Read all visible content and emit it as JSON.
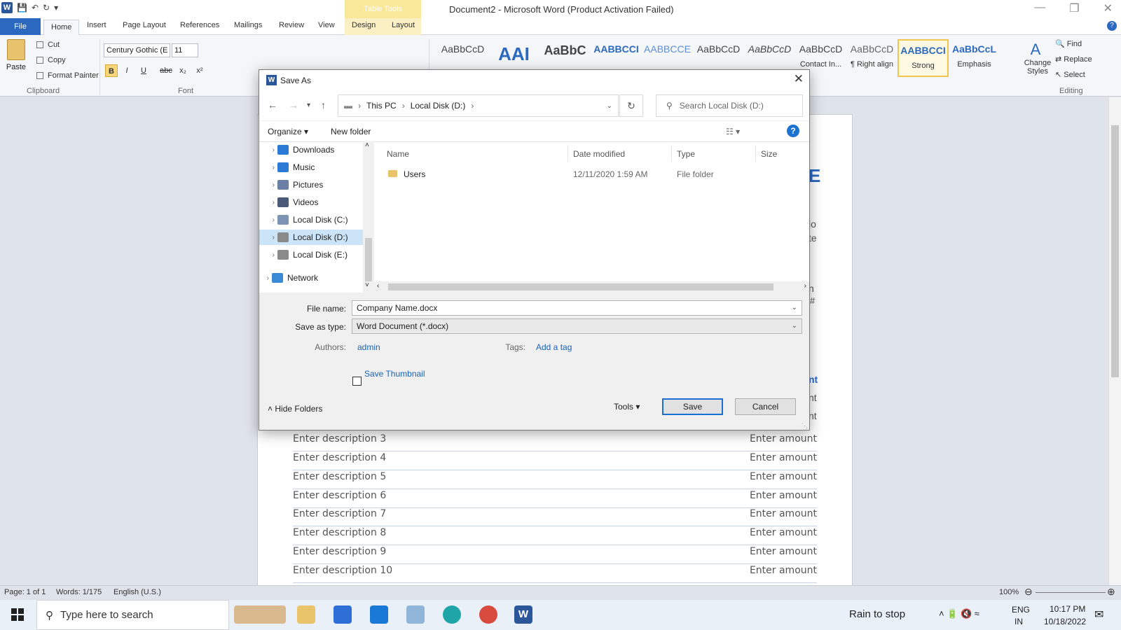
{
  "titlebar": {
    "title": "Document2 - Microsoft Word (Product Activation Failed)",
    "table_tools": "Table Tools",
    "minimize": "—",
    "restore": "❐",
    "close": "✕"
  },
  "ribbon_tabs": [
    "File",
    "Home",
    "Insert",
    "Page Layout",
    "References",
    "Mailings",
    "Review",
    "View",
    "Design",
    "Layout"
  ],
  "clipboard": {
    "paste": "Paste",
    "cut": "Cut",
    "copy": "Copy",
    "format_painter": "Format Painter",
    "group_label": "Clipboard"
  },
  "font": {
    "name": "Century Gothic (E",
    "size": "11",
    "group_label": "Font",
    "bold": "B",
    "italic": "I",
    "underline": "U",
    "strike": "abc",
    "subscript": "x₂",
    "superscript": "x²"
  },
  "styles": {
    "tiles": [
      {
        "sample": "AaBbCcD",
        "name": ""
      },
      {
        "sample": "AAI",
        "name": ""
      },
      {
        "sample": "AaBbC",
        "name": ""
      },
      {
        "sample": "AABBCCI",
        "name": ""
      },
      {
        "sample": "AABBCCE",
        "name": ""
      },
      {
        "sample": "AaBbCcD",
        "name": ""
      },
      {
        "sample": "AaBbCcD",
        "name": ""
      },
      {
        "sample": "AaBbCcD",
        "name": "Contact In..."
      },
      {
        "sample": "AaBbCcD",
        "name": "¶ Right align"
      },
      {
        "sample": "AABBCCI",
        "name": "Strong"
      },
      {
        "sample": "AaBbCcL",
        "name": "Emphasis"
      }
    ],
    "change_styles": "Change Styles",
    "group_label": "Styles"
  },
  "editing": {
    "find": "Find",
    "replace": "Replace",
    "select": "Select",
    "group_label": "Editing"
  },
  "document": {
    "rows": [
      {
        "desc": "Enter description 3",
        "amount": "Enter amount"
      },
      {
        "desc": "Enter description 4",
        "amount": "Enter amount"
      },
      {
        "desc": "Enter description 5",
        "amount": "Enter amount"
      },
      {
        "desc": "Enter description 6",
        "amount": "Enter amount"
      },
      {
        "desc": "Enter description 7",
        "amount": "Enter amount"
      },
      {
        "desc": "Enter description 8",
        "amount": "Enter amount"
      },
      {
        "desc": "Enter description 9",
        "amount": "Enter amount"
      },
      {
        "desc": "Enter description 10",
        "amount": "Enter amount"
      }
    ],
    "partial_right": [
      "E",
      "lo",
      "te",
      "n",
      "#",
      "nt",
      "nt",
      "nt"
    ]
  },
  "status": {
    "page": "Page: 1 of 1",
    "words": "Words: 1/175",
    "language": "English (U.S.)",
    "zoom": "100%"
  },
  "dialog": {
    "title": "Save As",
    "breadcrumb": [
      "This PC",
      "Local Disk (D:)"
    ],
    "search_placeholder": "Search Local Disk (D:)",
    "organize": "Organize",
    "new_folder": "New folder",
    "tree": [
      {
        "label": "Downloads",
        "color": "#2b7bd6"
      },
      {
        "label": "Music",
        "color": "#2b7bd6"
      },
      {
        "label": "Pictures",
        "color": "#6b7fa6"
      },
      {
        "label": "Videos",
        "color": "#4a5a78"
      },
      {
        "label": "Local Disk (C:)",
        "color": "#7c93b3"
      },
      {
        "label": "Local Disk (D:)",
        "color": "#8a8a8a"
      },
      {
        "label": "Local Disk (E:)",
        "color": "#8a8a8a"
      },
      {
        "label": "Network",
        "color": "#3a8ad6"
      }
    ],
    "columns": {
      "name": "Name",
      "date": "Date modified",
      "type": "Type",
      "size": "Size"
    },
    "files": [
      {
        "name": "Users",
        "date": "12/11/2020 1:59 AM",
        "type": "File folder"
      }
    ],
    "file_name_label": "File name:",
    "file_name": "Company Name.docx",
    "save_type_label": "Save as type:",
    "save_type": "Word Document (*.docx)",
    "authors_label": "Authors:",
    "authors": "admin",
    "tags_label": "Tags:",
    "tags": "Add a tag",
    "save_thumbnail": "Save Thumbnail",
    "hide_folders": "Hide Folders",
    "tools": "Tools",
    "save": "Save",
    "cancel": "Cancel"
  },
  "taskbar": {
    "search": "Type here to search",
    "weather": "Rain to stop",
    "lang1": "ENG",
    "lang2": "IN",
    "time": "10:17 PM",
    "date": "10/18/2022"
  }
}
